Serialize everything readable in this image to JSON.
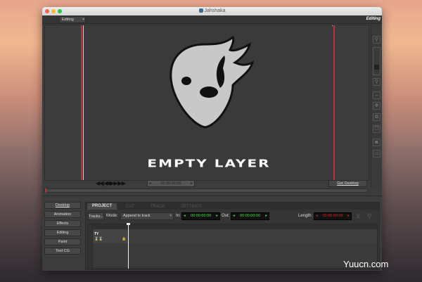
{
  "window": {
    "title": "Jahshaka"
  },
  "toolbar": {
    "mode_select": "Editing",
    "mode_label": "Editing"
  },
  "viewer": {
    "overlay_text": "EMPTY LAYER"
  },
  "transport": {
    "timecode": "00:00:00:00",
    "get_desktop": "Get Desktop"
  },
  "sidebar": {
    "items": [
      {
        "label": "Desktop"
      },
      {
        "label": "Animation"
      },
      {
        "label": "Effects"
      },
      {
        "label": "Editing"
      },
      {
        "label": "Paint"
      },
      {
        "label": "Text CG"
      }
    ]
  },
  "tabs": [
    {
      "label": "PROJECT"
    },
    {
      "label": "CUT"
    },
    {
      "label": "TRACK"
    },
    {
      "label": "SETTINGS"
    }
  ],
  "project": {
    "tracks_button": "Tracks...",
    "mode_label": "Mode:",
    "mode_value": "Append to track",
    "in_label": "In:",
    "in_value": "00:00:00:00",
    "out_label": "Out:",
    "out_value": "00:00:00:00",
    "length_label": "Length:",
    "length_value": "00:00:00:00"
  },
  "timeline": {
    "track_name": "TY"
  },
  "colors": {
    "green_tc": "#3ee03e",
    "red_tc": "#e02020",
    "accent_red": "#c0303a"
  }
}
